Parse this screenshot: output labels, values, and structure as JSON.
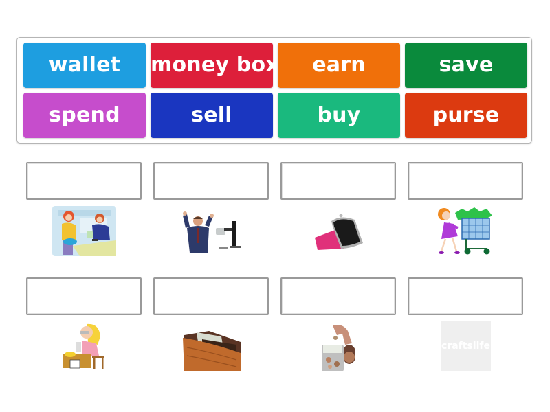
{
  "word_bank": {
    "tiles": [
      {
        "label": "wallet",
        "color": "#1e9ee0"
      },
      {
        "label": "money box",
        "color": "#dd1f3a"
      },
      {
        "label": "earn",
        "color": "#f0700a"
      },
      {
        "label": "save",
        "color": "#0a8a3c"
      },
      {
        "label": "spend",
        "color": "#c64dcc"
      },
      {
        "label": "sell",
        "color": "#1a36c0"
      },
      {
        "label": "buy",
        "color": "#1ab97e"
      },
      {
        "label": "purse",
        "color": "#dc3a10"
      }
    ]
  },
  "targets": [
    {
      "answer": "",
      "image": "shop-checkout-image"
    },
    {
      "answer": "",
      "image": "man-receiving-money-from-computer-image"
    },
    {
      "answer": "",
      "image": "open-pink-coin-purse-image"
    },
    {
      "answer": "",
      "image": "woman-with-cart-of-money-image"
    },
    {
      "answer": "",
      "image": "girl-selling-lemonade-image"
    },
    {
      "answer": "",
      "image": "leather-wallet-with-cash-image"
    },
    {
      "answer": "",
      "image": "child-putting-coin-in-jar-image"
    },
    {
      "answer": "",
      "image": "watermark-placeholder-image",
      "watermark_text": "craftslife"
    }
  ]
}
